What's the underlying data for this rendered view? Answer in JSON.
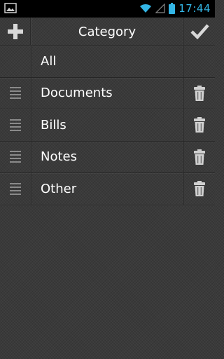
{
  "status_bar": {
    "time": "17:44",
    "icons": [
      "gallery-notification-icon",
      "wifi-icon",
      "signal-icon",
      "battery-icon"
    ]
  },
  "action_bar": {
    "title": "Category",
    "add_icon": "plus-icon",
    "done_icon": "checkmark-icon"
  },
  "categories": [
    {
      "label": "All",
      "reorderable": false,
      "deletable": false
    },
    {
      "label": "Documents",
      "reorderable": true,
      "deletable": true
    },
    {
      "label": "Bills",
      "reorderable": true,
      "deletable": true
    },
    {
      "label": "Notes",
      "reorderable": true,
      "deletable": true
    },
    {
      "label": "Other",
      "reorderable": true,
      "deletable": true
    }
  ],
  "colors": {
    "accent": "#33b5e5",
    "background": "#3a3a3a",
    "icon": "#d0d0d0"
  }
}
